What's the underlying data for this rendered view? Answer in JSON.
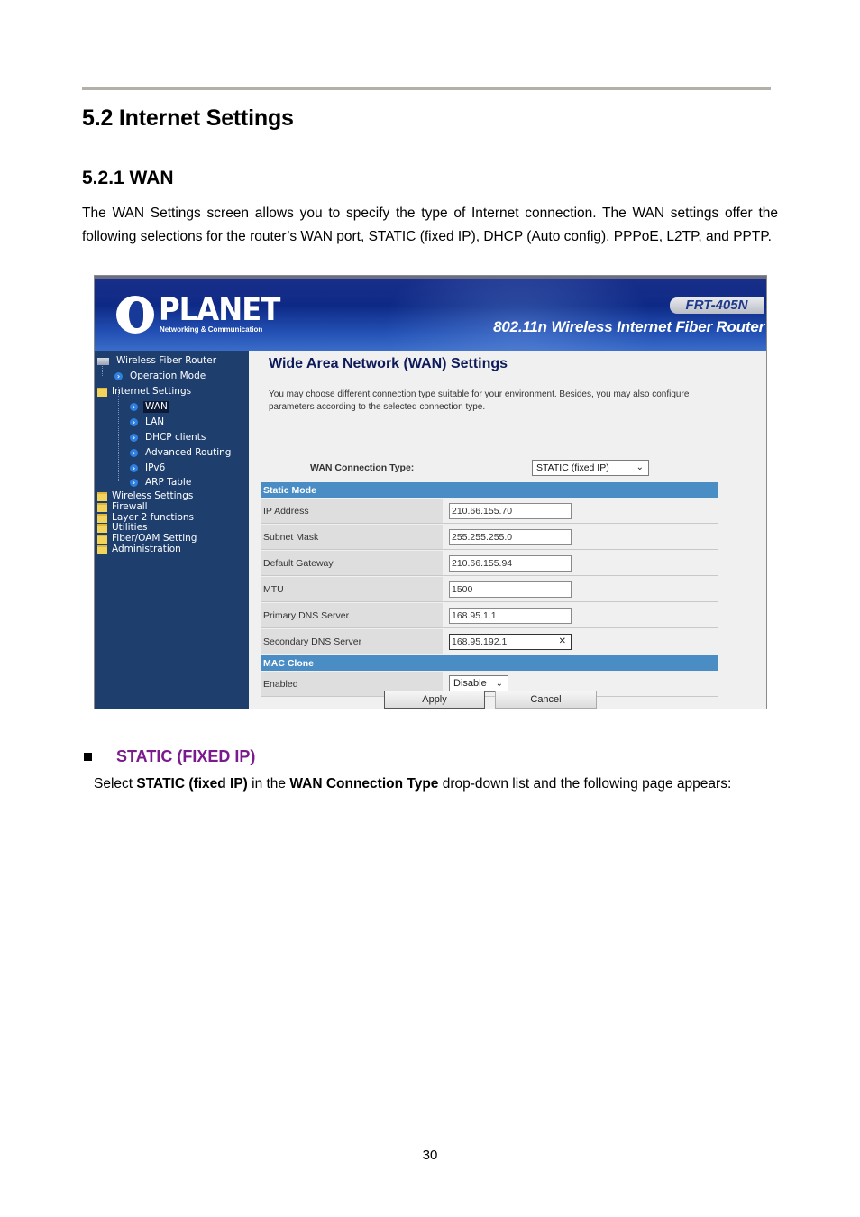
{
  "document": {
    "section_title": "5.2 Internet Settings",
    "subsection_title": "5.2.1 WAN",
    "intro": "The WAN Settings screen allows you to specify the type of Internet connection. The WAN settings offer the following selections for the router’s WAN port, STATIC (fixed IP), DHCP (Auto config), PPPoE, L2TP, and PPTP.",
    "bullet_heading": "STATIC (FIXED IP)",
    "instruction": {
      "pre": "Select ",
      "bold1": "STATIC (fixed IP)",
      "mid": " in the ",
      "bold2": "WAN Connection Type",
      "post": " drop-down list and the following page appears:"
    },
    "page_number": "30"
  },
  "router": {
    "brand": "PLANET",
    "brand_tagline": "Networking & Communication",
    "model": "FRT-405N",
    "product_name": "802.11n Wireless Internet Fiber Router",
    "sidebar": {
      "root": "Wireless Fiber Router",
      "items": [
        {
          "label": "Operation Mode",
          "type": "page"
        },
        {
          "label": "Internet Settings",
          "type": "folder-open"
        },
        {
          "label": "WAN",
          "type": "page",
          "active": true
        },
        {
          "label": "LAN",
          "type": "page"
        },
        {
          "label": "DHCP clients",
          "type": "page"
        },
        {
          "label": "Advanced Routing",
          "type": "page"
        },
        {
          "label": "IPv6",
          "type": "page"
        },
        {
          "label": "ARP Table",
          "type": "page"
        },
        {
          "label": "Wireless Settings",
          "type": "folder"
        },
        {
          "label": "Firewall",
          "type": "folder"
        },
        {
          "label": "Layer 2 functions",
          "type": "folder"
        },
        {
          "label": "Utilities",
          "type": "folder"
        },
        {
          "label": "Fiber/OAM Setting",
          "type": "folder"
        },
        {
          "label": "Administration",
          "type": "folder"
        }
      ]
    },
    "content": {
      "title": "Wide Area Network (WAN) Settings",
      "description": "You may choose different connection type suitable for your environment. Besides, you may also configure parameters according to the selected connection type.",
      "connection_type_label": "WAN Connection Type:",
      "connection_type_value": "STATIC (fixed IP)",
      "static_section": "Static Mode",
      "fields": [
        {
          "label": "IP Address",
          "value": "210.66.155.70"
        },
        {
          "label": "Subnet Mask",
          "value": "255.255.255.0"
        },
        {
          "label": "Default Gateway",
          "value": "210.66.155.94"
        },
        {
          "label": "MTU",
          "value": "1500"
        },
        {
          "label": "Primary DNS Server",
          "value": "168.95.1.1"
        },
        {
          "label": "Secondary DNS Server",
          "value": "168.95.192.1"
        }
      ],
      "mac_section": "MAC Clone",
      "mac_enabled_label": "Enabled",
      "mac_enabled_value": "Disable",
      "apply_label": "Apply",
      "cancel_label": "Cancel"
    },
    "colors": {
      "sidebar_bg": "#1e3e6e",
      "section_header": "#4a8cc4",
      "title_color": "#0d1a5a",
      "bullet_heading": "#7b1a8c"
    }
  }
}
